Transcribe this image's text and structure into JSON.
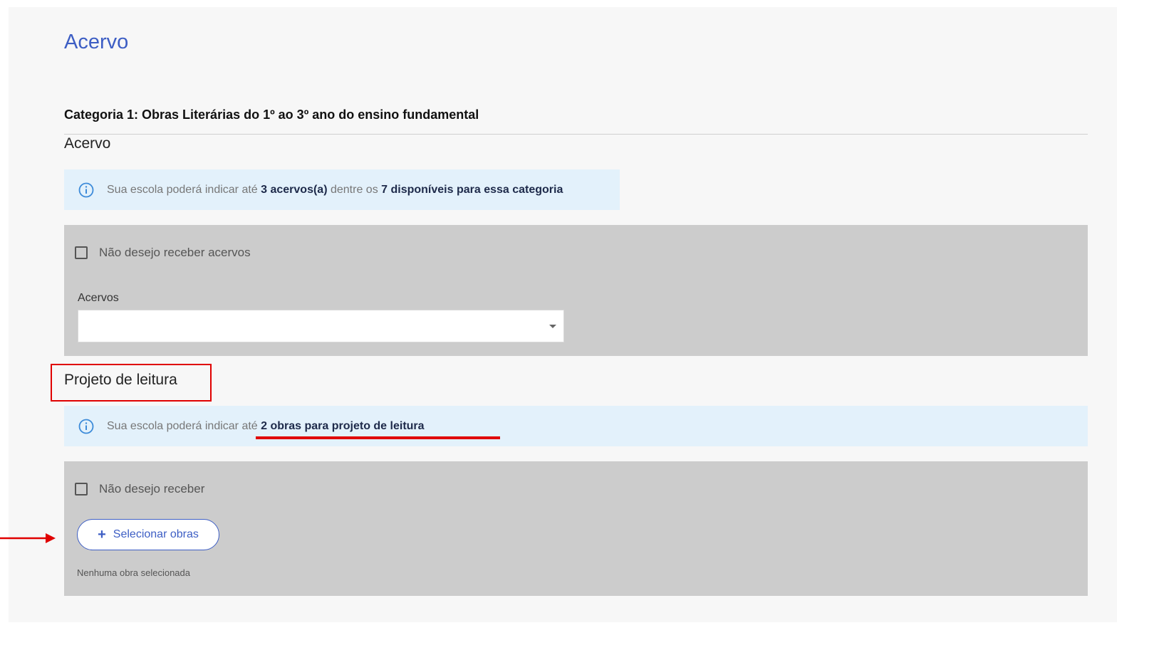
{
  "page": {
    "title": "Acervo"
  },
  "category": {
    "title": "Categoria 1: Obras Literárias do 1º ao 3º ano do ensino fundamental"
  },
  "acervo_section": {
    "heading": "Acervo",
    "info": {
      "prefix": "Sua escola poderá indicar até ",
      "strong1": "3 acervos(a)",
      "middle": " dentre os ",
      "strong2": "7 disponíveis para essa categoria"
    },
    "opt_out_label": "Não desejo receber acervos",
    "field_label": "Acervos",
    "select_value": ""
  },
  "reading_project_section": {
    "heading": "Projeto de leitura",
    "info": {
      "prefix": "Sua escola poderá indicar até ",
      "strong": "2 obras para projeto de leitura"
    },
    "opt_out_label": "Não desejo receber",
    "select_button_label": "Selecionar obras",
    "empty_hint": "Nenhuma obra selecionada"
  },
  "colors": {
    "accent": "#3d5ec4",
    "info_background": "#e3f1fb",
    "panel_background": "#cccccc",
    "annotation": "#e00000"
  },
  "icons": {
    "info": "info-circle-icon",
    "plus": "plus-icon",
    "caret": "caret-down-icon"
  }
}
